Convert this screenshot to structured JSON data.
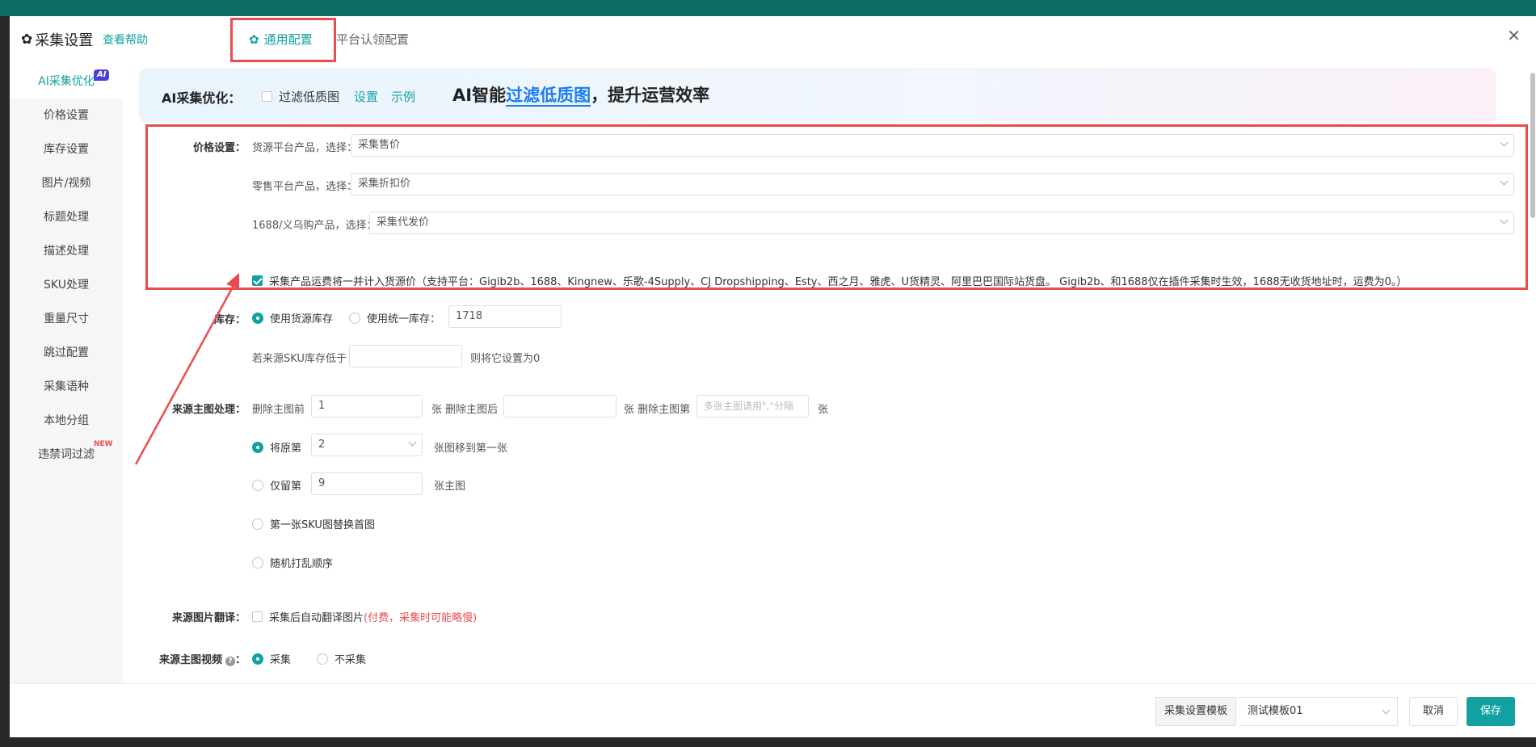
{
  "header": {
    "title": "采集设置",
    "help_link": "查看帮助",
    "tabs": [
      {
        "label": "通用配置",
        "active": true
      },
      {
        "label": "平台认领配置",
        "active": false
      }
    ],
    "close_icon": "close-icon"
  },
  "sidebar": {
    "items": [
      {
        "label": "AI采集优化",
        "active": true,
        "badge": "AI"
      },
      {
        "label": "价格设置"
      },
      {
        "label": "库存设置"
      },
      {
        "label": "图片/视频"
      },
      {
        "label": "标题处理"
      },
      {
        "label": "描述处理"
      },
      {
        "label": "SKU处理"
      },
      {
        "label": "重量尺寸"
      },
      {
        "label": "跳过配置"
      },
      {
        "label": "采集语种"
      },
      {
        "label": "本地分组"
      },
      {
        "label": "违禁词过滤",
        "badge": "NEW"
      }
    ]
  },
  "ai_banner": {
    "label": "AI采集优化：",
    "checkbox_label": "过滤低质图",
    "checked": false,
    "settings_link": "设置",
    "demo_link": "示例",
    "slogan_prefix": "AI智能",
    "slogan_highlight": "过滤低质图",
    "slogan_suffix": "，提升运营效率"
  },
  "price": {
    "label": "价格设置：",
    "rows": [
      {
        "label": "货源平台产品，选择：",
        "value": "采集售价"
      },
      {
        "label": "零售平台产品，选择：",
        "value": "采集折扣价"
      },
      {
        "label": "1688/义乌购产品，选择：",
        "value": "采集代发价"
      }
    ],
    "shipping_checkbox": {
      "checked": true,
      "text": "采集产品运费将一并计入货源价（支持平台：Gigib2b、1688、Kingnew、乐歌-4Supply、CJ Dropshipping、Esty、西之月、雅虎、U货精灵、阿里巴巴国际站货盘。 Gigib2b、和1688仅在插件采集时生效，1688无收货地址时，运费为0。）"
    }
  },
  "stock": {
    "label": "库存：",
    "option_source": "使用货源库存",
    "option_unified": "使用统一库存：",
    "unified_value": "1718",
    "low_prefix": "若来源SKU库存低于",
    "low_value": "",
    "low_suffix": "则将它设置为0"
  },
  "main_image": {
    "label": "来源主图处理：",
    "del_front_prefix": "删除主图前",
    "del_front_value": "1",
    "del_front_unit": "张 删除主图后",
    "del_back_value": "",
    "del_back_unit": "张 删除主图第",
    "del_nth_placeholder": "多张主图请用\",\"分隔",
    "del_nth_unit": "张",
    "move_label": "将原第",
    "move_value": "2",
    "move_suffix": "张图移到第一张",
    "keep_label": "仅留第",
    "keep_value": "9",
    "keep_suffix": "张主图",
    "sku_first": "第一张SKU图替换首图",
    "shuffle": "随机打乱顺序"
  },
  "translate": {
    "label": "来源图片翻译：",
    "checkbox_label": "采集后自动翻译图片",
    "note": "(付费，采集时可能略慢)"
  },
  "video": {
    "label": "来源主图视频",
    "opt_collect": "采集",
    "opt_skip": "不采集"
  },
  "footer": {
    "template_label": "采集设置模板",
    "template_value": "测试模板01",
    "cancel": "取消",
    "save": "保存"
  },
  "colors": {
    "accent": "#12a1a0",
    "highlight_red": "#e84c4f",
    "ai_badge": "#4a3fd8",
    "slogan_blue": "#1b7cf0"
  }
}
